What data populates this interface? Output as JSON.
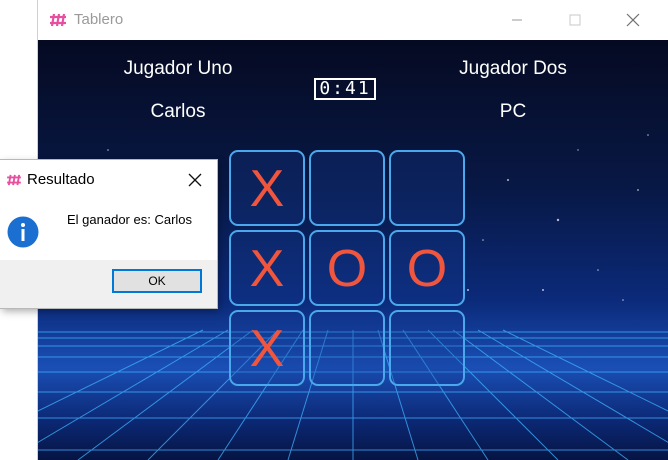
{
  "window": {
    "title": "Tablero",
    "icon": "app-logo-icon",
    "controls": [
      "minimize-icon",
      "maximize-icon",
      "close-icon"
    ]
  },
  "game": {
    "player1_title": "Jugador Uno",
    "player2_title": "Jugador Dos",
    "player1_name": "Carlos",
    "player2_name": "PC",
    "timer": "0:41",
    "board": [
      [
        "X",
        "",
        ""
      ],
      [
        "X",
        "O",
        "O"
      ],
      [
        "X",
        "",
        ""
      ]
    ],
    "mark_color": "#f0553e",
    "cell_border_color": "#4aa8ec"
  },
  "dialog": {
    "title": "Resultado",
    "icon": "info-icon",
    "message": "El ganador es: Carlos",
    "ok_label": "OK"
  }
}
